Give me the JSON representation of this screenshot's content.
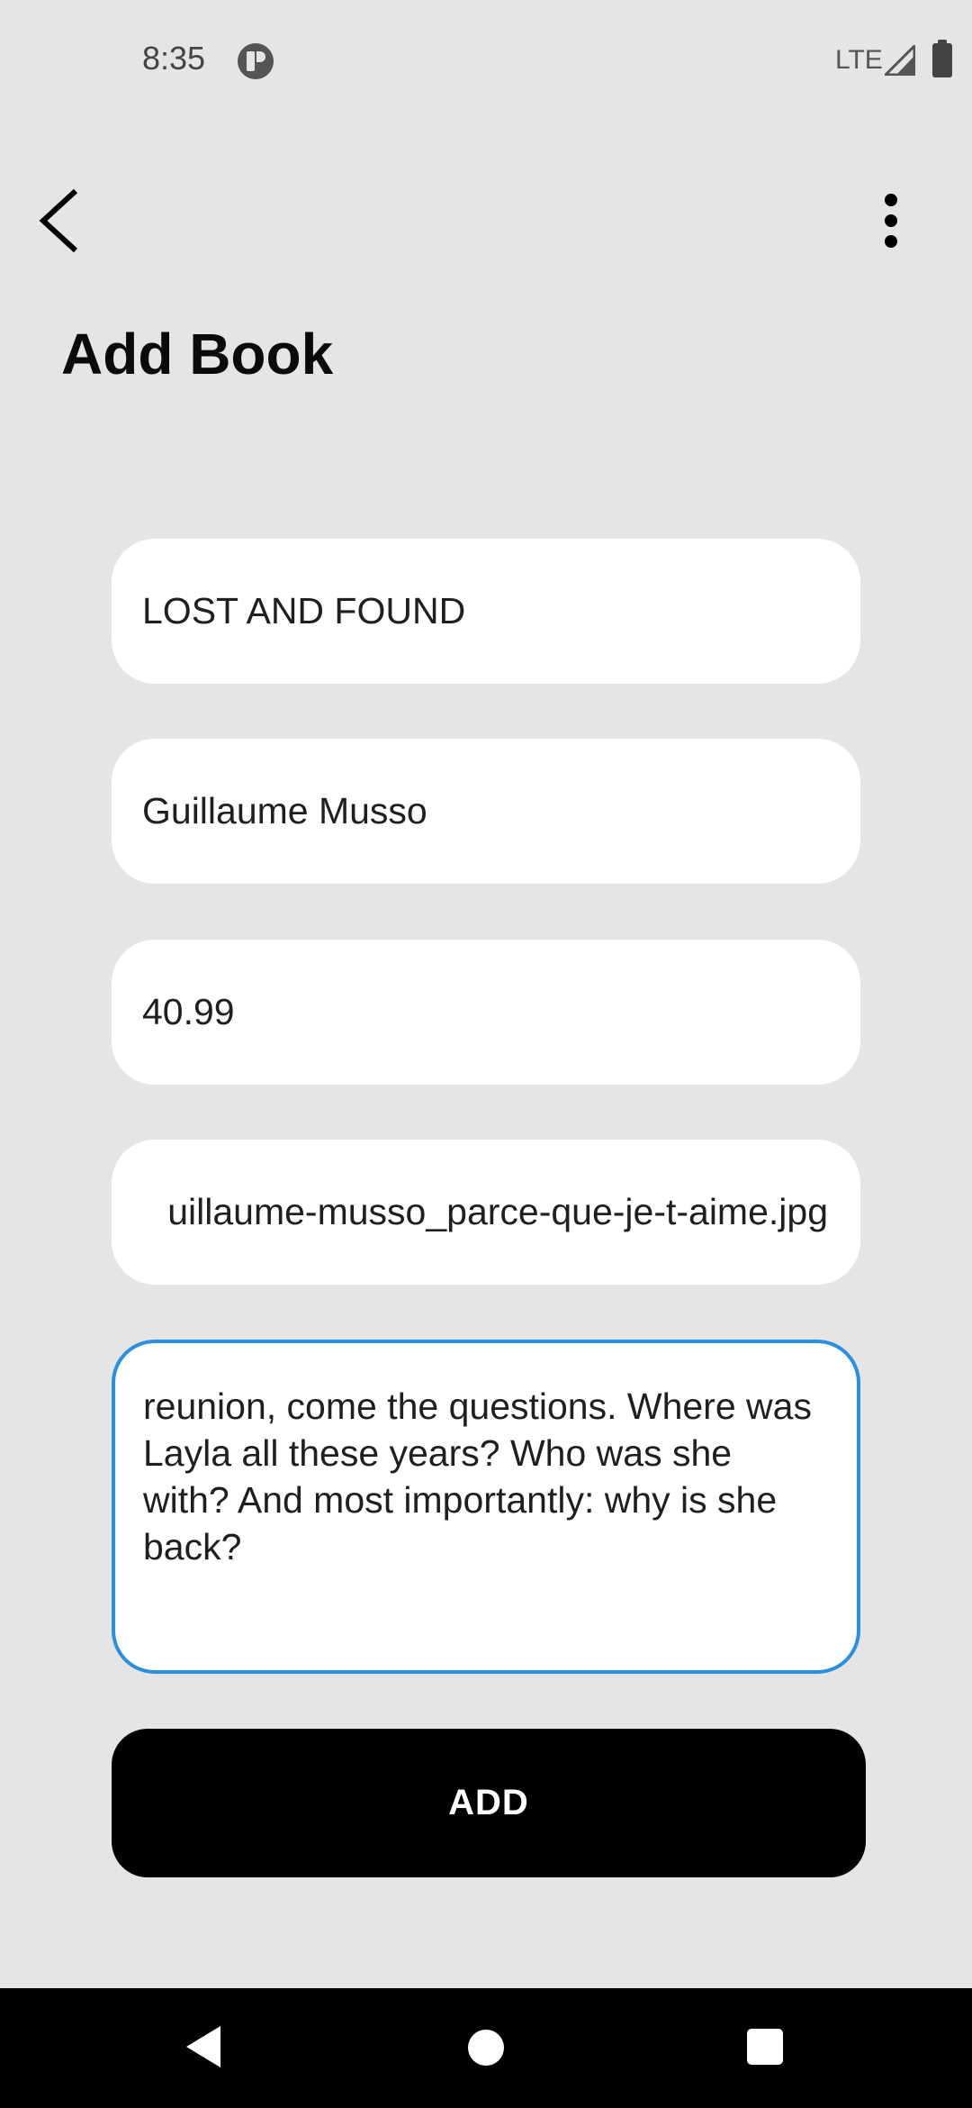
{
  "status_bar": {
    "time": "8:35",
    "network": "LTE",
    "icons": [
      "app-notification-icon",
      "signal-icon",
      "battery-icon"
    ]
  },
  "app_bar": {
    "back_icon": "chevron-left-icon",
    "menu_icon": "more-vertical-icon"
  },
  "page": {
    "title": "Add Book"
  },
  "form": {
    "title_value": "LOST AND FOUND",
    "author_value": "Guillaume Musso",
    "price_value": "40.99",
    "image_value": "uillaume-musso_parce-que-je-t-aime.jpg",
    "description_value": "reunion, come the questions. Where was Layla all these years? Who was she with? And most importantly: why is she back?",
    "description_focused": true
  },
  "actions": {
    "add_label": "ADD"
  },
  "colors": {
    "background": "#e5e5e5",
    "field_background": "#ffffff",
    "focus_border": "#2b8fe0",
    "primary_button": "#000000"
  },
  "nav_bar": {
    "icons": [
      "nav-back-icon",
      "nav-home-icon",
      "nav-recents-icon"
    ]
  }
}
